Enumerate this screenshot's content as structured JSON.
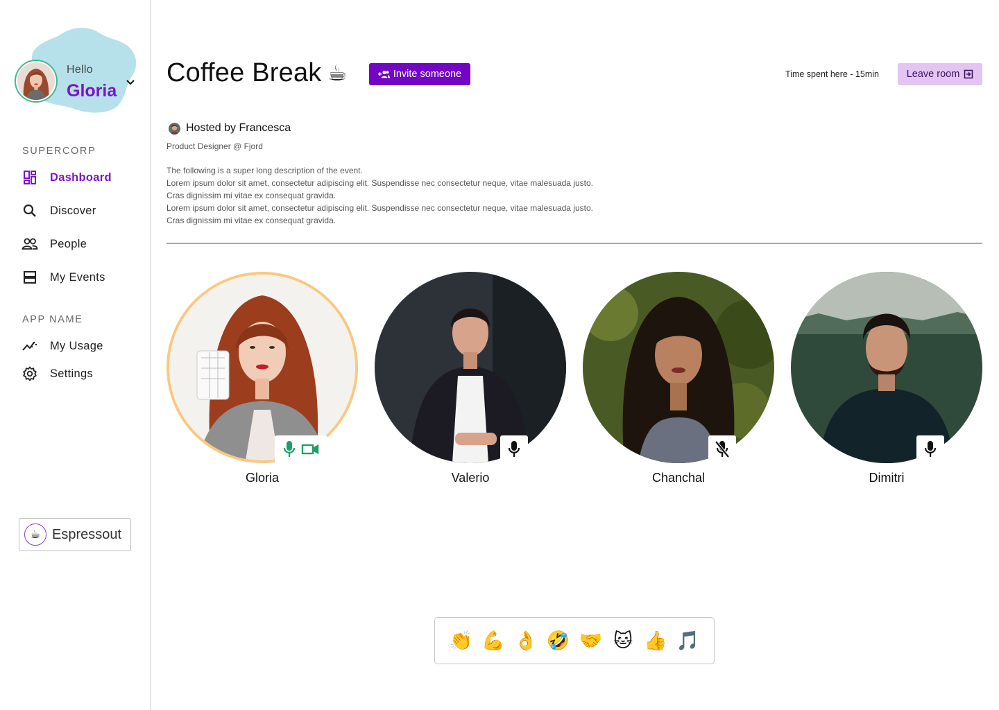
{
  "user": {
    "greeting": "Hello",
    "name": "Gloria"
  },
  "sidebar": {
    "sections": [
      {
        "label": "SUPERCORP",
        "items": [
          {
            "label": "Dashboard",
            "icon": "dashboard-icon",
            "active": true
          },
          {
            "label": "Discover",
            "icon": "search-icon"
          },
          {
            "label": "People",
            "icon": "people-icon"
          },
          {
            "label": "My Events",
            "icon": "events-icon"
          }
        ]
      },
      {
        "label": "APP NAME",
        "items": [
          {
            "label": "My Usage",
            "icon": "usage-chart-icon"
          },
          {
            "label": "Settings",
            "icon": "gear-icon"
          }
        ]
      }
    ],
    "workspace": {
      "label": "Espressout",
      "icon": "☕"
    }
  },
  "room": {
    "title": "Coffee Break",
    "emoji": "☕",
    "invite_label": "Invite someone",
    "time_spent": "Time spent here - 15min",
    "leave_label": "Leave room"
  },
  "host": {
    "line": "Hosted by Francesca",
    "role": "Product Designer @ Fjord",
    "description": [
      "The following is a super long description of the event.",
      "Lorem ipsum dolor sit amet, consectetur adipiscing elit. Suspendisse nec consectetur neque, vitae malesuada justo.",
      "Cras dignissim mi vitae ex consequat gravida.",
      "Lorem ipsum dolor sit amet, consectetur adipiscing elit. Suspendisse nec consectetur neque, vitae malesuada justo.",
      "Cras dignissim mi vitae ex consequat gravida."
    ]
  },
  "participants": [
    {
      "name": "Gloria",
      "mic": "on",
      "video": "on",
      "speaking": true
    },
    {
      "name": "Valerio",
      "mic": "on"
    },
    {
      "name": "Chanchal",
      "mic": "muted"
    },
    {
      "name": "Dimitri",
      "mic": "on"
    }
  ],
  "reactions": [
    "👏",
    "💪",
    "👌",
    "🤣",
    "🤝",
    "🐱",
    "👍",
    "🎵"
  ],
  "colors": {
    "accent": "#7206c4",
    "leave_bg": "#e3c4f2",
    "speaking_ring": "#f9c980",
    "mic_active": "#1e9e6a",
    "blob": "#b6e1ea"
  }
}
